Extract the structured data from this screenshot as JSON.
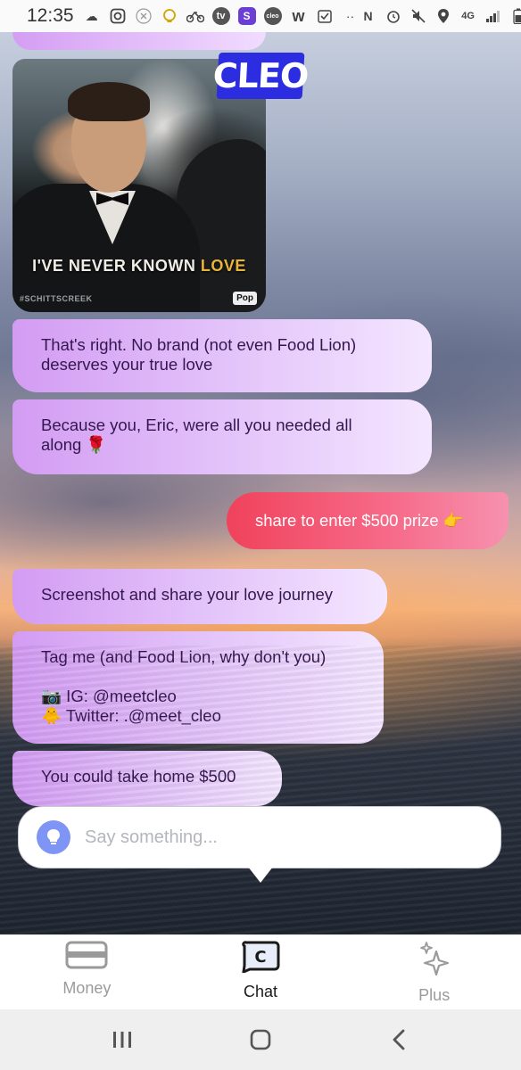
{
  "status_bar": {
    "time": "12:35",
    "icons_left": [
      "cloud-icon",
      "instagram-icon",
      "x-circle-icon",
      "lightbulb-icon",
      "bike-icon",
      "tv-icon",
      "s-app-icon",
      "cleo-app-icon",
      "w-app-icon",
      "checkbox-icon",
      "more-dots-icon"
    ],
    "icons_right": [
      "nfc-icon",
      "alarm-icon",
      "mute-icon",
      "location-icon",
      "4g-lte-icon",
      "signal-icon",
      "battery-icon"
    ],
    "network_label": "4G"
  },
  "chat": {
    "gif": {
      "caption_main": "I'VE NEVER KNOWN ",
      "caption_accent": "LOVE",
      "hashtag": "#SCHITTSCREEK",
      "logo": "Pop"
    },
    "badge": "CLEO",
    "messages": [
      {
        "from": "cleo",
        "text": "That's right. No brand (not even Food Lion)\ndeserves your true love"
      },
      {
        "from": "cleo",
        "text": "Because you, Eric, were all you needed all\nalong 🌹"
      },
      {
        "from": "user",
        "text": "share to enter $500 prize 👉"
      },
      {
        "from": "cleo",
        "text": "Screenshot and share your love journey"
      },
      {
        "from": "cleo",
        "text": "Tag me (and Food Lion, why don't you)\n\n📷 IG: @meetcleo\n🐥 Twitter: .@meet_cleo"
      },
      {
        "from": "cleo",
        "text": "You could take home $500"
      }
    ]
  },
  "input": {
    "placeholder": "Say something..."
  },
  "bottom_nav": {
    "items": [
      {
        "label": "Money",
        "icon": "card-icon",
        "active": false
      },
      {
        "label": "Chat",
        "icon": "chat-c-icon",
        "active": true
      },
      {
        "label": "Plus",
        "icon": "sparkle-icon",
        "active": false
      }
    ]
  },
  "colors": {
    "cleo_bubble_start": "#d39cf3",
    "cleo_bubble_end": "#f4e6ff",
    "cleo_text": "#35174f",
    "user_bubble_start": "#f0425c",
    "user_bubble_end": "#f791b0",
    "badge": "#2c2de0",
    "bulb": "#7f95f5"
  }
}
